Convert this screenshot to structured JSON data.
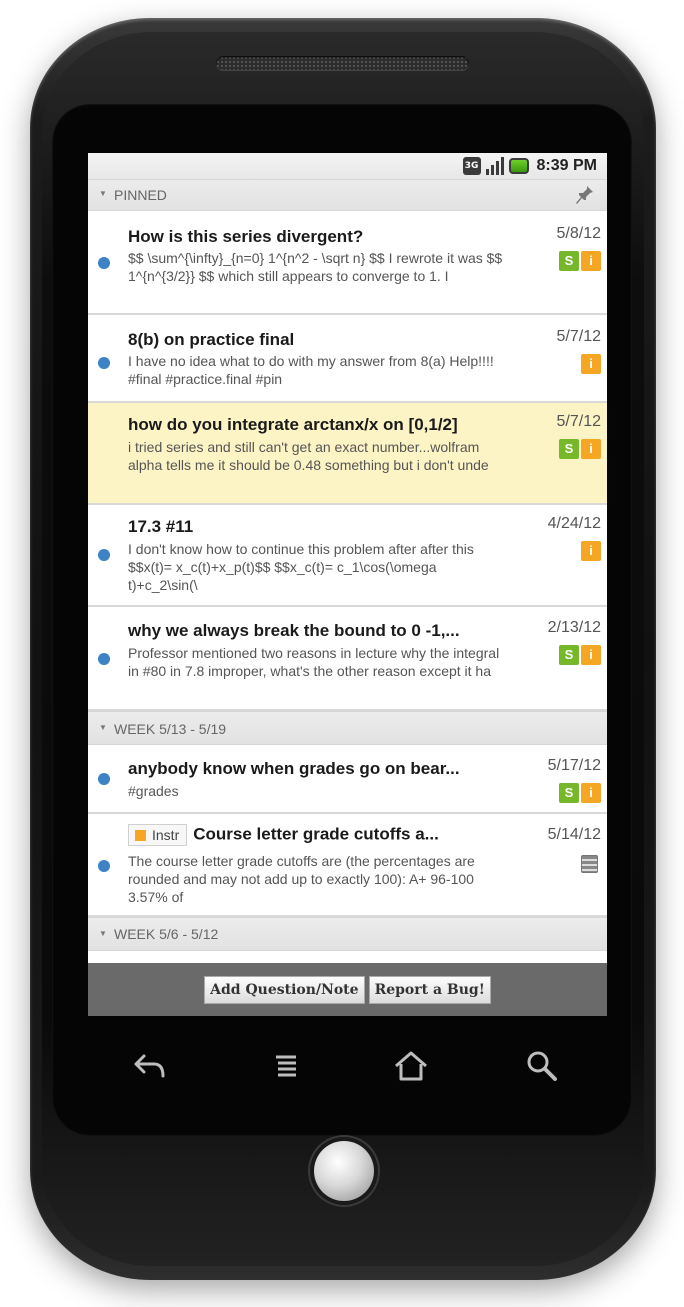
{
  "status": {
    "network": "3G",
    "time": "8:39 PM"
  },
  "sections": {
    "pinned": "PINNED",
    "week1": "WEEK 5/13 - 5/19",
    "week2": "WEEK 5/6 - 5/12"
  },
  "posts": [
    {
      "title": "How is this series divergent?",
      "preview": "$$ \\sum^{\\infty}_{n=0} 1^{n^2 - \\sqrt n} $$ I rewrote it was $$ 1^{n^{3/2}} $$ which still appears to converge to 1. I",
      "date": "5/8/12",
      "badges": [
        "S",
        "i"
      ],
      "unread": true
    },
    {
      "title": "8(b) on practice final",
      "preview": "I have no idea what to do with my answer from 8(a) Help!!!! #final #practice.final #pin",
      "date": "5/7/12",
      "badges": [
        "i"
      ],
      "unread": true
    },
    {
      "title": "how do you integrate arctanx/x on [0,1/2]",
      "preview": "i tried series and still can't get an exact number...wolfram alpha tells me it should be 0.48 something but i don't unde",
      "date": "5/7/12",
      "badges": [
        "S",
        "i"
      ],
      "unread": false
    },
    {
      "title": "17.3 #11",
      "preview": "I don't know how to continue this problem after after this $$x(t)= x_c(t)+x_p(t)$$ $$x_c(t)= c_1\\cos(\\omega t)+c_2\\sin(\\",
      "date": "4/24/12",
      "badges": [
        "i"
      ],
      "unread": true
    },
    {
      "title": "why we always break the bound to 0 -1,...",
      "preview": "Professor mentioned two reasons in lecture why the integral in #80 in 7.8 improper, what's the other reason except it ha",
      "date": "2/13/12",
      "badges": [
        "S",
        "i"
      ],
      "unread": true
    },
    {
      "title": "anybody know when grades go on bear...",
      "preview": "#grades",
      "date": "5/17/12",
      "badges": [
        "S",
        "i"
      ],
      "unread": true
    },
    {
      "title": "Course letter grade cutoffs a...",
      "tag": "Instr",
      "preview": "The course letter grade cutoffs are (the percentages are rounded and may not add up to exactly 100): A+ 96-100 3.57% of",
      "date": "5/14/12",
      "badges": [],
      "unread": true
    }
  ],
  "toolbar": {
    "add_label": "Add Question/Note",
    "bug_label": "Report a Bug!"
  },
  "icons": {
    "pin": "pin-icon",
    "back": "back-icon",
    "menu": "menu-icon",
    "home": "home-icon",
    "search": "search-icon",
    "note": "note-icon"
  },
  "colors": {
    "unread_dot": "#3d82c4",
    "student_badge": "#76b82a",
    "instructor_badge": "#f5a623",
    "highlight_row": "#fdf4c6"
  }
}
